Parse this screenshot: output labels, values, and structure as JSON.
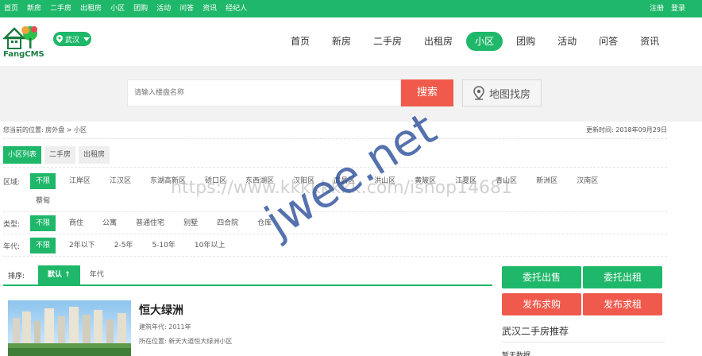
{
  "topbar": {
    "links": [
      "首页",
      "新房",
      "二手房",
      "出租房",
      "小区",
      "团购",
      "活动",
      "问答",
      "资讯",
      "经纪人"
    ],
    "auth": [
      "注册",
      "登录"
    ]
  },
  "header": {
    "logo_text": "FangCMS",
    "city": "武汉",
    "nav": [
      {
        "label": "首页",
        "active": false
      },
      {
        "label": "新房",
        "active": false
      },
      {
        "label": "二手房",
        "active": false
      },
      {
        "label": "出租房",
        "active": false
      },
      {
        "label": "小区",
        "active": true
      },
      {
        "label": "团购",
        "active": false
      },
      {
        "label": "活动",
        "active": false
      },
      {
        "label": "问答",
        "active": false
      },
      {
        "label": "资讯",
        "active": false
      }
    ]
  },
  "search": {
    "placeholder": "请输入楼盘名称",
    "button_label": "搜索",
    "map_button_label": "地图找房"
  },
  "breadcrumb": {
    "text": "您当前的位置: 房外盘 > 小区",
    "updated": "更新时间: 2018年09月29日"
  },
  "tabs": [
    {
      "label": "小区列表",
      "active": true
    },
    {
      "label": "二手房",
      "active": false
    },
    {
      "label": "出租房",
      "active": false
    }
  ],
  "filters": {
    "district": {
      "label": "区域:",
      "options": [
        "不限",
        "江岸区",
        "江汉区",
        "东湖高新区",
        "硚口区",
        "东西湖区",
        "汉阳区",
        "武昌区",
        "洪山区",
        "黄陂区",
        "江夏区",
        "青山区",
        "新洲区",
        "汉南区"
      ],
      "extra": "蔡甸"
    },
    "type": {
      "label": "类型:",
      "options": [
        "不限",
        "商住",
        "公寓",
        "普通住宅",
        "别墅",
        "四合院",
        "仓库"
      ]
    },
    "age": {
      "label": "年代:",
      "options": [
        "不限",
        "2年以下",
        "2-5年",
        "5-10年",
        "10年以上"
      ]
    }
  },
  "sort": {
    "label": "排序:",
    "options": [
      {
        "label": "默认 ↑",
        "active": true
      },
      {
        "label": "年代",
        "active": false
      }
    ]
  },
  "listing": {
    "title": "恒大绿洲",
    "built": "建筑年代: 2011年",
    "location": "所在位置: 新天大道恒大绿洲小区"
  },
  "sidebar": {
    "buttons": [
      "委托出售",
      "委托出租",
      "发布求购",
      "发布求租"
    ],
    "title": "武汉二手房推荐",
    "sub": "暂无数据"
  },
  "watermark": {
    "main": "jwee.net",
    "url": "https://www.kkkkkkkk.com/ishop14681"
  },
  "colors": {
    "brand_green": "#1fb769",
    "accent_red": "#f05a4c"
  }
}
